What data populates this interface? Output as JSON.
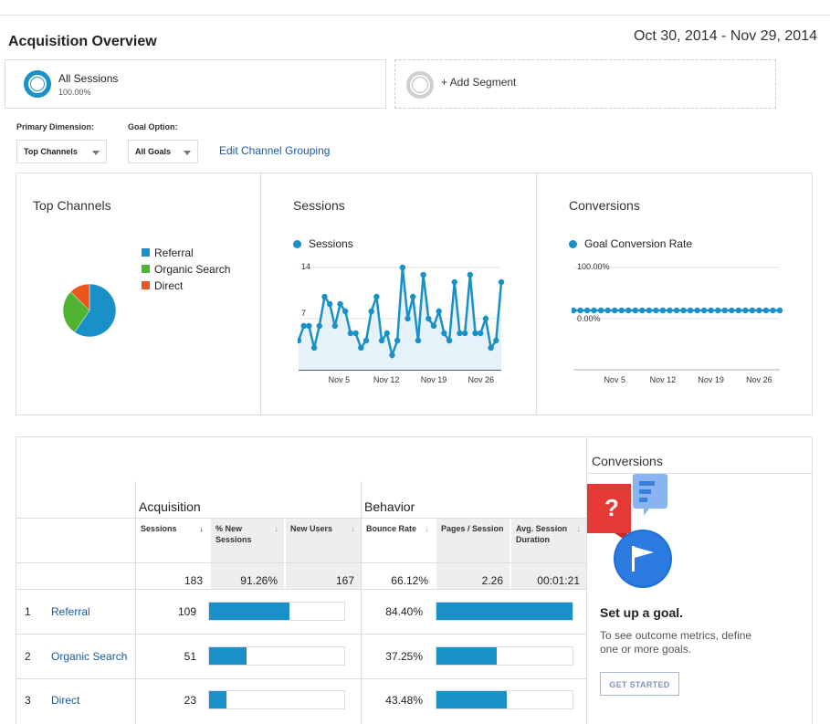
{
  "page": {
    "title": "Acquisition Overview",
    "date_range": "Oct 30, 2014 - Nov 29, 2014"
  },
  "segments": {
    "all": {
      "name": "All Sessions",
      "pct": "100.00%"
    },
    "add_label": "+ Add Segment"
  },
  "options": {
    "primary_label": "Primary Dimension:",
    "primary_value": "Top Channels",
    "goal_label": "Goal Option:",
    "goal_value": "All Goals",
    "edit_link": "Edit Channel Grouping"
  },
  "panels": {
    "top_channels": {
      "title": "Top Channels",
      "legend": [
        "Referral",
        "Organic Search",
        "Direct"
      ]
    },
    "sessions": {
      "title": "Sessions",
      "legend": "Sessions",
      "y_ticks": [
        "14",
        "7"
      ],
      "x_ticks": [
        "Nov 5",
        "Nov 12",
        "Nov 19",
        "Nov 26"
      ]
    },
    "conversions": {
      "title": "Conversions",
      "legend": "Goal Conversion Rate",
      "y_ticks": [
        "100.00%",
        "0.00%"
      ],
      "x_ticks": [
        "Nov 5",
        "Nov 12",
        "Nov 19",
        "Nov 26"
      ]
    }
  },
  "chart_data": [
    {
      "type": "pie",
      "categories": [
        "Referral",
        "Organic Search",
        "Direct"
      ],
      "values": [
        109,
        51,
        23
      ],
      "colors": [
        "#1a90c8",
        "#50b432",
        "#ed561b"
      ]
    },
    {
      "type": "line",
      "series": [
        {
          "name": "Sessions",
          "values": [
            4,
            6,
            6,
            3,
            6,
            10,
            9,
            6,
            9,
            8,
            5,
            5,
            3,
            4,
            8,
            10,
            4,
            5,
            2,
            4,
            14,
            7,
            10,
            4,
            13,
            7,
            6,
            8,
            5,
            4,
            12,
            5,
            5,
            13,
            5,
            5,
            7,
            3,
            4,
            12
          ]
        }
      ],
      "ylim": [
        0,
        14
      ],
      "x_ticks": [
        "Nov 5",
        "Nov 12",
        "Nov 19",
        "Nov 26"
      ],
      "color": "#1a90c8"
    },
    {
      "type": "line",
      "series": [
        {
          "name": "Goal Conversion Rate",
          "values": [
            0,
            0,
            0,
            0,
            0,
            0,
            0,
            0,
            0,
            0,
            0,
            0,
            0,
            0,
            0,
            0,
            0,
            0,
            0,
            0,
            0,
            0,
            0,
            0,
            0,
            0,
            0,
            0,
            0,
            0,
            0
          ]
        }
      ],
      "ylim": [
        0,
        100
      ],
      "y_ticks": [
        "100.00%",
        "0.00%"
      ],
      "x_ticks": [
        "Nov 5",
        "Nov 12",
        "Nov 19",
        "Nov 26"
      ],
      "color": "#1a90c8"
    }
  ],
  "table": {
    "groups": {
      "acquisition": "Acquisition",
      "behavior": "Behavior"
    },
    "headers": [
      "Sessions",
      "% New Sessions",
      "New Users",
      "Bounce Rate",
      "Pages / Session",
      "Avg. Session Duration"
    ],
    "totals": [
      "183",
      "91.26%",
      "167",
      "66.12%",
      "2.26",
      "00:01:21"
    ],
    "rows": [
      {
        "num": "1",
        "channel": "Referral",
        "sessions": "109",
        "sessions_frac": 0.596,
        "bounce": "84.40%",
        "bounce_frac": 1.0
      },
      {
        "num": "2",
        "channel": "Organic Search",
        "sessions": "51",
        "sessions_frac": 0.279,
        "bounce": "37.25%",
        "bounce_frac": 0.441
      },
      {
        "num": "3",
        "channel": "Direct",
        "sessions": "23",
        "sessions_frac": 0.126,
        "bounce": "43.48%",
        "bounce_frac": 0.515
      }
    ]
  },
  "conversions_box": {
    "title": "Conversions",
    "goal_title": "Set up a goal.",
    "goal_desc": "To see outcome metrics, define one or more goals.",
    "button": "GET STARTED"
  },
  "icons": {
    "sort_active": "sort-down-arrow-icon",
    "sort": "sort-arrow-icon",
    "goal_illustration": "question-flag-icon"
  }
}
